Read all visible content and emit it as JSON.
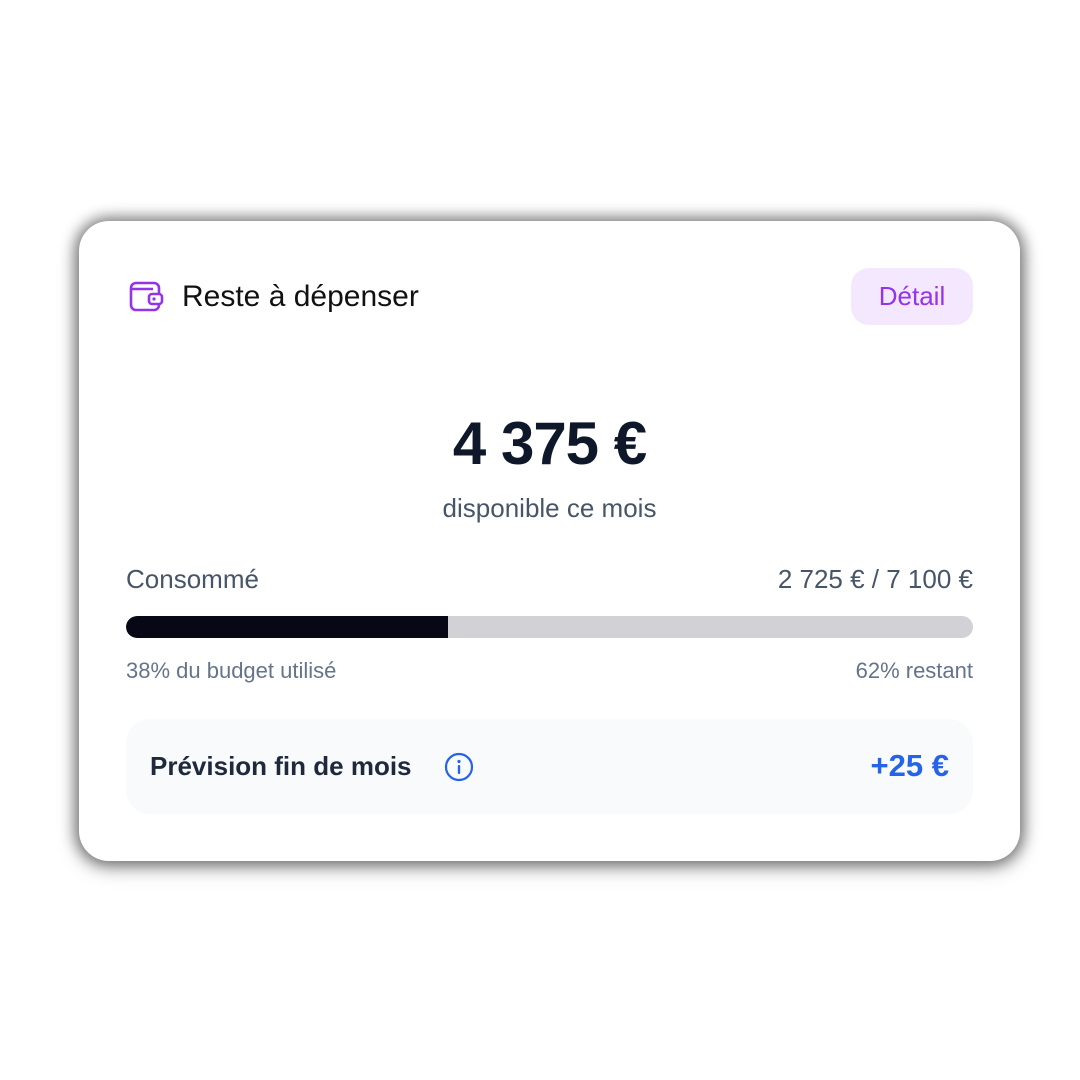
{
  "card": {
    "icon": "wallet-icon",
    "title": "Reste à dépenser",
    "detail_label": "Détail",
    "accent_color": "#9333ea"
  },
  "balance": {
    "amount": "4 375 €",
    "caption": "disponible ce mois"
  },
  "consumption": {
    "label": "Consommé",
    "value": "2 725 € / 7 100 €",
    "progress_fraction": 0.38,
    "used_text": "38% du budget utilisé",
    "remaining_text": "62% restant"
  },
  "forecast": {
    "label": "Prévision fin de mois",
    "info_icon": "info-icon",
    "value": "+25 €",
    "value_color": "#2563eb"
  }
}
